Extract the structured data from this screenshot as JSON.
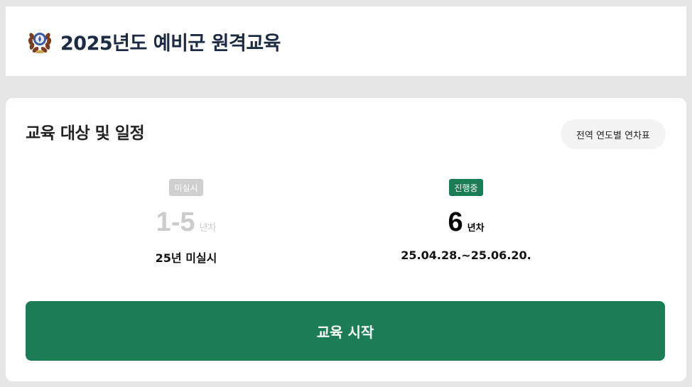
{
  "header": {
    "emblem_icon": "reserve-forces-emblem-icon",
    "title": "2025년도 예비군 원격교육"
  },
  "schedule": {
    "title": "교육 대상 및 일정",
    "chart_button_label": "전역 연도별 연차표",
    "groups": [
      {
        "status": "미실시",
        "year_value": "1-5",
        "year_unit": "년차",
        "period": "25년 미실시"
      },
      {
        "status": "진행중",
        "year_value": "6",
        "year_unit": "년차",
        "period": "25.04.28.~25.06.20."
      }
    ]
  },
  "actions": {
    "start_label": "교육 시작"
  },
  "colors": {
    "primary": "#1b7c56",
    "pending_badge": "#cfcfcf",
    "title_text": "#1c2a44"
  }
}
